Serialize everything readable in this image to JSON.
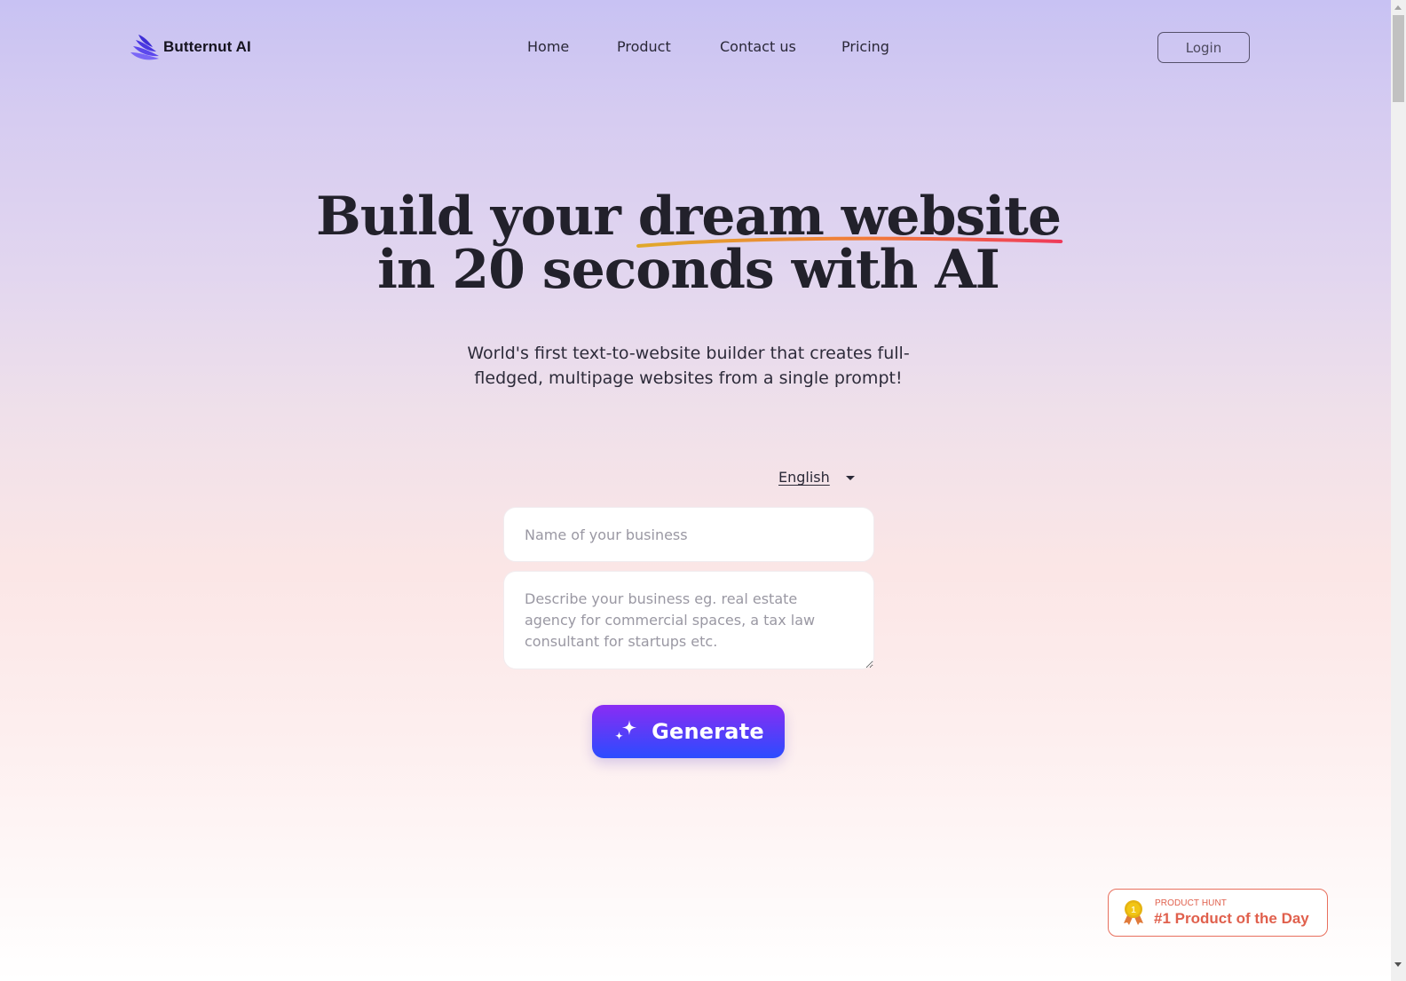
{
  "brand": {
    "name": "Butternut AI",
    "logo_icon": "layered-wing-icon",
    "logo_color": "#5b3ff0"
  },
  "nav": {
    "items": [
      {
        "label": "Home"
      },
      {
        "label": "Product"
      },
      {
        "label": "Contact us"
      },
      {
        "label": "Pricing"
      }
    ],
    "login_label": "Login"
  },
  "hero": {
    "title_line1_before": "Build your ",
    "title_line1_highlight": "dream website",
    "title_line2": "in 20 seconds with AI",
    "underline_colors": [
      "#e0a92a",
      "#f27a3a",
      "#ef3a5a"
    ],
    "subtitle": "World's first text-to-website builder that creates full-fledged, multipage websites from a single prompt!"
  },
  "form": {
    "language": {
      "selected": "English",
      "icon": "caret-down-icon"
    },
    "business_name": {
      "value": "",
      "placeholder": "Name of your business"
    },
    "business_description": {
      "value": "",
      "placeholder": "Describe your business eg. real estate agency for commercial spaces, a tax law consultant for startups etc."
    },
    "generate": {
      "label": "Generate",
      "icon": "sparkles-icon",
      "gradient": [
        "#8a2cf4",
        "#2b4cff"
      ]
    }
  },
  "badge": {
    "source": "PRODUCT HUNT",
    "title": "#1 Product of the Day",
    "icon": "medal-icon",
    "medal_number": "1",
    "accent": "#e0604d"
  }
}
